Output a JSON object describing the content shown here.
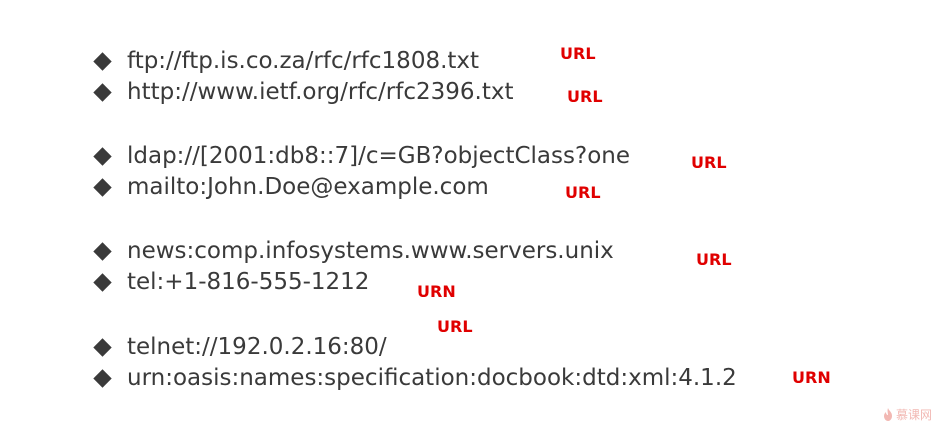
{
  "items": [
    {
      "uri": "ftp://ftp.is.co.za/rfc/rfc1808.txt",
      "type": "URL"
    },
    {
      "uri": "http://www.ietf.org/rfc/rfc2396.txt",
      "type": "URL"
    },
    {
      "uri": "ldap://[2001:db8::7]/c=GB?objectClass?one",
      "type": "URL"
    },
    {
      "uri": "mailto:John.Doe@example.com",
      "type": "URL"
    },
    {
      "uri": "news:comp.infosystems.www.servers.unix",
      "type": "URL"
    },
    {
      "uri": "tel:+1-816-555-1212",
      "type": "URN"
    },
    {
      "uri": "telnet://192.0.2.16:80/",
      "type": "URL"
    },
    {
      "uri": "urn:oasis:names:specification:docbook:dtd:xml:4.1.2",
      "type": "URN"
    }
  ],
  "watermark": {
    "text": "慕课网"
  },
  "colors": {
    "text": "#3a3a3a",
    "tag": "#e00000",
    "watermark": "#f2b8b3"
  }
}
